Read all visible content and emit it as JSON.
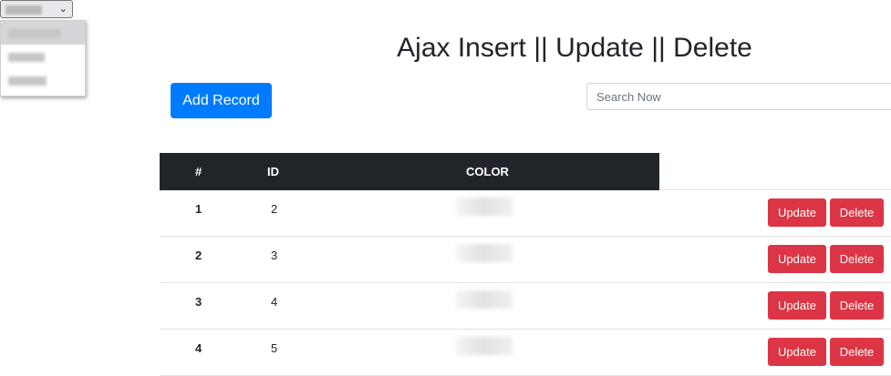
{
  "header": {
    "title": "Ajax Insert || Update || Delete",
    "add_button": "Add Record",
    "search_placeholder": "Search Now"
  },
  "select": {
    "chevron": "⌄",
    "options_visible": 3
  },
  "table": {
    "columns": [
      "#",
      "ID",
      "COLOR"
    ],
    "rows": [
      {
        "num": "1",
        "id": "2",
        "update": "Update",
        "delete": "Delete"
      },
      {
        "num": "2",
        "id": "3",
        "update": "Update",
        "delete": "Delete"
      },
      {
        "num": "3",
        "id": "4",
        "update": "Update",
        "delete": "Delete"
      },
      {
        "num": "4",
        "id": "5",
        "update": "Update",
        "delete": "Delete"
      }
    ]
  },
  "colors": {
    "primary": "#007bff",
    "danger": "#dc3545",
    "header_bg": "#212529"
  }
}
